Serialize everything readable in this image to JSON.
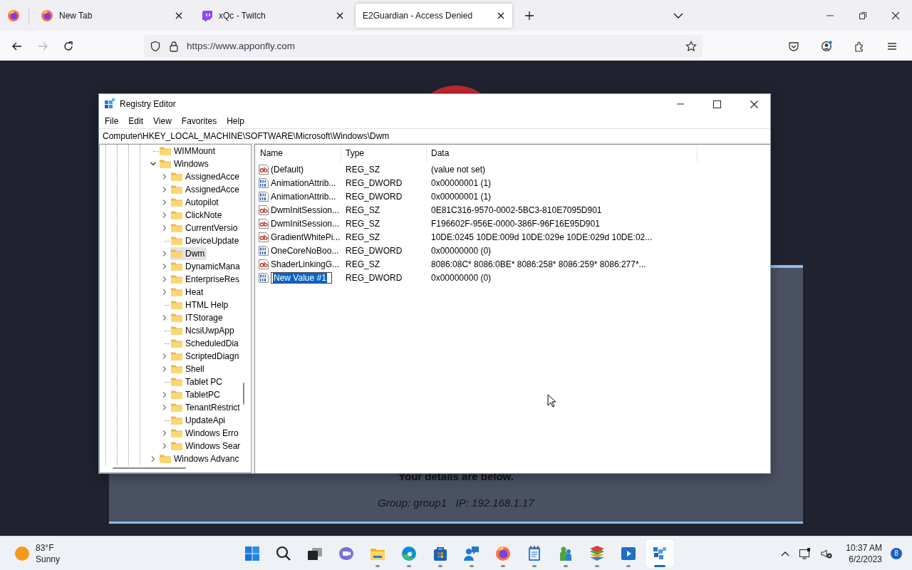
{
  "browser": {
    "tabs": [
      {
        "label": "New Tab",
        "selected": false
      },
      {
        "label": "xQc - Twitch",
        "selected": false
      },
      {
        "label": "E2Guardian - Access Denied",
        "selected": true
      }
    ],
    "address": "https://www.apponfly.com",
    "forward_disabled": true
  },
  "page": {
    "details_heading": "Your details are below.",
    "details_line": "Group: group1   IP: 192.168.1.17"
  },
  "registry": {
    "title": "Registry Editor",
    "menu": [
      "File",
      "Edit",
      "View",
      "Favorites",
      "Help"
    ],
    "path": "Computer\\HKEY_LOCAL_MACHINE\\SOFTWARE\\Microsoft\\Windows\\Dwm",
    "tree": [
      {
        "label": "WIMMount",
        "selected": false
      },
      {
        "label": "Windows",
        "expanded": true,
        "selected": false,
        "children": [
          {
            "label": "AssignedAcce",
            "expanded": false,
            "selected": false
          },
          {
            "label": "AssignedAcce",
            "expanded": false,
            "selected": false
          },
          {
            "label": "Autopilot",
            "expanded": false,
            "selected": false
          },
          {
            "label": "ClickNote",
            "expanded": false,
            "selected": false
          },
          {
            "label": "CurrentVersio",
            "expanded": false,
            "selected": false
          },
          {
            "label": "DeviceUpdate",
            "selected": false
          },
          {
            "label": "Dwm",
            "expanded": false,
            "selected": true
          },
          {
            "label": "DynamicMana",
            "expanded": false,
            "selected": false
          },
          {
            "label": "EnterpriseRes",
            "expanded": false,
            "selected": false
          },
          {
            "label": "Heat",
            "expanded": false,
            "selected": false
          },
          {
            "label": "HTML Help",
            "selected": false
          },
          {
            "label": "ITStorage",
            "expanded": false,
            "selected": false
          },
          {
            "label": "NcsiUwpApp",
            "selected": false
          },
          {
            "label": "ScheduledDia",
            "selected": false
          },
          {
            "label": "ScriptedDiagn",
            "expanded": false,
            "selected": false
          },
          {
            "label": "Shell",
            "expanded": false,
            "selected": false
          },
          {
            "label": "Tablet PC",
            "selected": false
          },
          {
            "label": "TabletPC",
            "expanded": false,
            "selected": false
          },
          {
            "label": "TenantRestrict",
            "expanded": false,
            "selected": false
          },
          {
            "label": "UpdateApi",
            "selected": false
          },
          {
            "label": "Windows Erro",
            "expanded": false,
            "selected": false
          },
          {
            "label": "Windows Sear",
            "expanded": false,
            "selected": false
          }
        ]
      },
      {
        "label": "Windows Advanc",
        "expanded": false,
        "selected": false
      }
    ],
    "columns": [
      "Name",
      "Type",
      "Data"
    ],
    "values": [
      {
        "kind": "string",
        "name": "(Default)",
        "type": "REG_SZ",
        "data": "(value not set)",
        "editing": false
      },
      {
        "kind": "binary",
        "name": "AnimationAttrib...",
        "type": "REG_DWORD",
        "data": "0x00000001 (1)",
        "editing": false
      },
      {
        "kind": "binary",
        "name": "AnimationAttrib...",
        "type": "REG_DWORD",
        "data": "0x00000001 (1)",
        "editing": false
      },
      {
        "kind": "string",
        "name": "DwmInitSession...",
        "type": "REG_SZ",
        "data": "0E81C316-9570-0002-5BC3-810E7095D901",
        "editing": false
      },
      {
        "kind": "string",
        "name": "DwmInitSession...",
        "type": "REG_SZ",
        "data": "F196602F-956E-0000-386F-96F16E95D901",
        "editing": false
      },
      {
        "kind": "string",
        "name": "GradientWhitePi...",
        "type": "REG_SZ",
        "data": "10DE:0245 10DE:009d 10DE:029e 10DE:029d 10DE:02...",
        "editing": false
      },
      {
        "kind": "binary",
        "name": "OneCoreNoBoo...",
        "type": "REG_DWORD",
        "data": "0x00000000 (0)",
        "editing": false
      },
      {
        "kind": "string",
        "name": "ShaderLinkingG...",
        "type": "REG_SZ",
        "data": "8086:08C* 8086:0BE* 8086:258* 8086:259* 8086:277*...",
        "editing": false
      },
      {
        "kind": "binary",
        "name": "New Value #1",
        "type": "REG_DWORD",
        "data": "0x00000000 (0)",
        "editing": true
      }
    ]
  },
  "taskbar": {
    "weather": {
      "temp": "83°F",
      "condition": "Sunny"
    },
    "apps": [
      {
        "running": false,
        "active": false
      },
      {
        "running": false,
        "active": false
      },
      {
        "running": false,
        "active": false
      },
      {
        "running": false,
        "active": false
      },
      {
        "running": true,
        "active": false
      },
      {
        "running": true,
        "active": false
      },
      {
        "running": true,
        "active": false
      },
      {
        "running": true,
        "active": false
      },
      {
        "running": true,
        "active": false
      },
      {
        "running": true,
        "active": false
      },
      {
        "running": true,
        "active": false
      },
      {
        "running": true,
        "active": false
      },
      {
        "running": true,
        "active": false
      },
      {
        "running": true,
        "active": true
      }
    ],
    "time": "10:37 AM",
    "date": "6/2/2023",
    "notifications": "8"
  }
}
